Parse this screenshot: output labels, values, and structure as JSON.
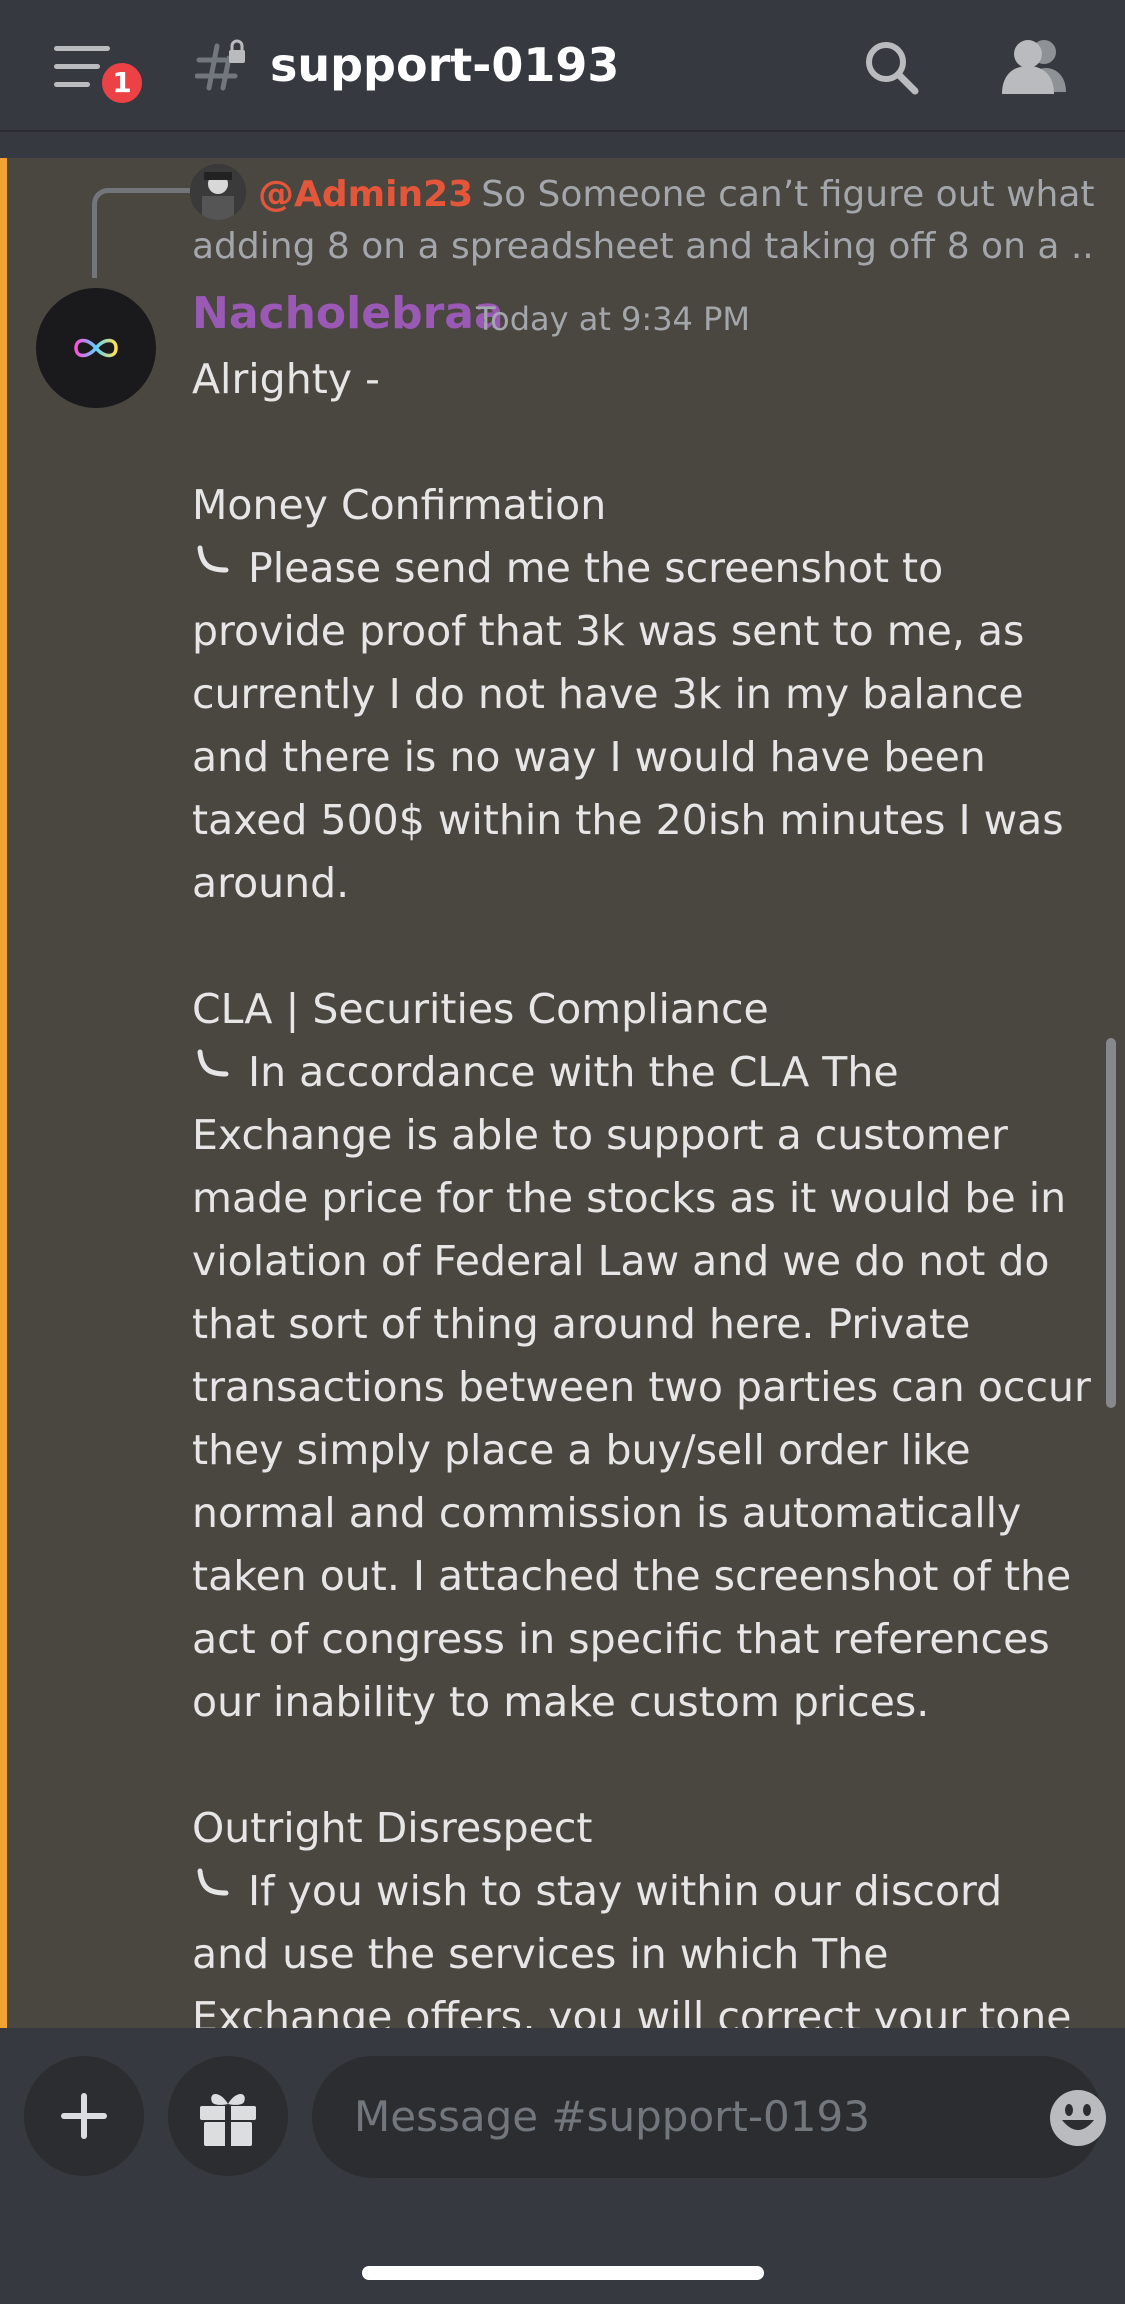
{
  "header": {
    "channel_name": "support-0193",
    "notification_count": "1"
  },
  "reply": {
    "mention": "@Admin23",
    "preview_line1": "So Someone can’t figure out what",
    "preview_line2": "adding 8 on a spreadsheet and taking off 8 on a ..."
  },
  "message": {
    "author": "Nacholebraa",
    "author_color": "#9b59b6",
    "timestamp": "Today at 9:34 PM",
    "greeting": "Alrighty -",
    "sections": [
      {
        "heading": "Money Confirmation",
        "body": "Please send me the screenshot to provide proof that 3k was sent to me, as currently I do not have 3k in my balance and there is no way I would have been taxed 500$ within the 20ish minutes I was around."
      },
      {
        "heading": "CLA | Securities Compliance",
        "body": "In accordance with the CLA The Exchange is able to support a customer made price for the stocks as it would be in violation of Federal Law and we do not do that sort of thing around here. Private transactions between two parties can occur they simply place a buy/sell order like normal and commission is automatically taken out. I attached the screenshot of the act of congress in specific that references our inability to make custom prices."
      },
      {
        "heading": "Outright Disrespect",
        "body": "If you wish to stay within our discord and use the services in which The Exchange offers, you will correct your tone and attitude when speaking to anyone on our staff."
      }
    ]
  },
  "composer": {
    "placeholder": "Message #support-0193"
  },
  "colors": {
    "highlight": "#f0a232",
    "mention": "#e3563a",
    "badge": "#ed4245"
  }
}
